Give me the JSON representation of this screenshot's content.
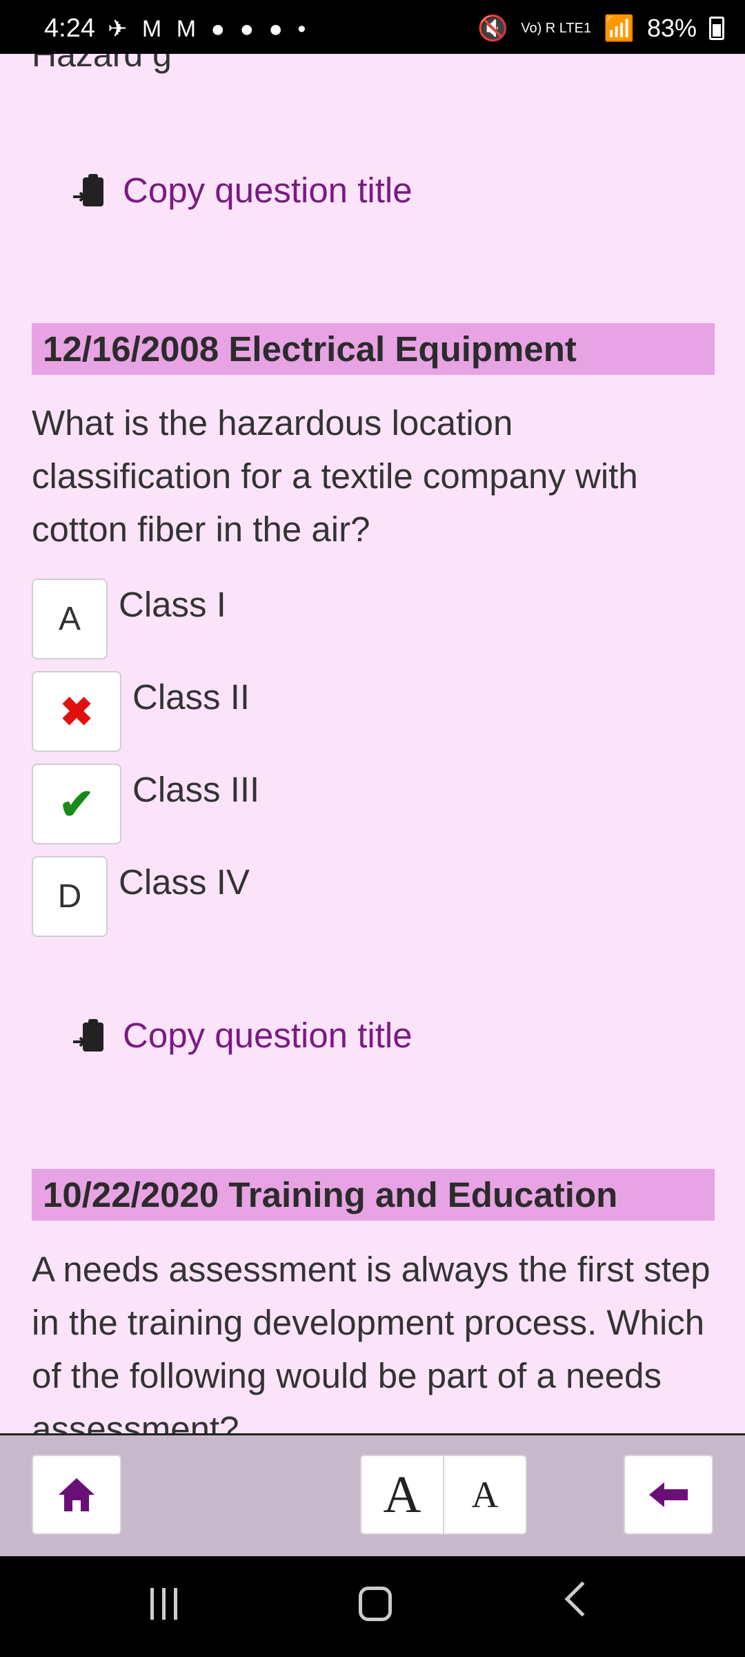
{
  "status": {
    "time": "4:24",
    "left_icons": "✈ M M ● ● ● •",
    "signal_text": "Vo) R LTE1",
    "battery": "83%"
  },
  "content": {
    "top_clipped_text": "Hazard g",
    "copy_label": "Copy question title",
    "questions": [
      {
        "header": "12/16/2008 Electrical Equipment",
        "text": "What is the hazardous location classification for a textile company with cotton fiber in the air?",
        "answers": [
          {
            "marker": "A",
            "label": "Class I",
            "state": "none"
          },
          {
            "marker": "",
            "label": "Class II",
            "state": "wrong",
            "icon": "x-icon"
          },
          {
            "marker": "",
            "label": "Class III",
            "state": "correct",
            "icon": "check-icon"
          },
          {
            "marker": "D",
            "label": "Class IV",
            "state": "none"
          }
        ]
      },
      {
        "header": "10/22/2020 Training and Education",
        "text": "A needs assessment is always the first step in the training development process. Which of the following would be part of a needs assessment?"
      }
    ]
  },
  "toolbar": {
    "font_large_label": "A",
    "font_small_label": "A",
    "home_icon": "home-icon",
    "back_icon": "arrow-left-icon"
  },
  "colors": {
    "background": "#fbe3fa",
    "header_bg": "#e7a3e3",
    "accent": "#7a1a82",
    "toolbar_bg": "#c8b8cb",
    "wrong": "#e01010",
    "correct": "#1a8a1a"
  }
}
